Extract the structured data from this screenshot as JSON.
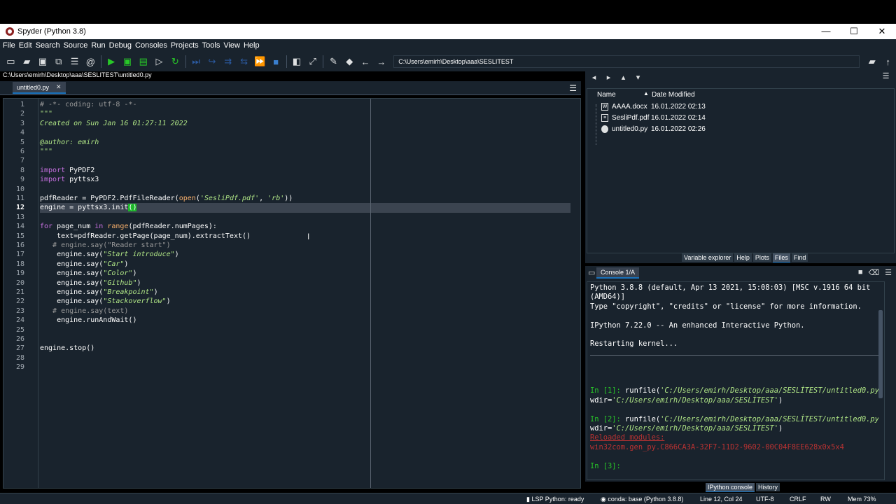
{
  "window": {
    "title": "Spyder (Python 3.8)",
    "controls": [
      "—",
      "☐",
      "✕"
    ]
  },
  "menu": [
    "File",
    "Edit",
    "Search",
    "Source",
    "Run",
    "Debug",
    "Consoles",
    "Projects",
    "Tools",
    "View",
    "Help"
  ],
  "toolbar": {
    "working_dir": "C:\\Users\\emirh\\Desktop\\aaa\\SESLITEST"
  },
  "editor": {
    "file_path": "C:\\Users\\emirh\\Desktop\\aaa\\SESLITEST\\untitled0.py",
    "tab_label": "untitled0.py",
    "current_line": 12,
    "line_numbers": [
      "1",
      "2",
      "3",
      "4",
      "5",
      "6",
      "7",
      "8",
      "9",
      "10",
      "11",
      "12",
      "13",
      "14",
      "15",
      "16",
      "17",
      "18",
      "19",
      "20",
      "21",
      "22",
      "23",
      "24",
      "25",
      "26",
      "27",
      "28",
      "29"
    ]
  },
  "files": {
    "col_name": "Name",
    "col_date": "Date Modified",
    "items": [
      {
        "name": "AAAA.docx",
        "date": "16.01.2022 02:13",
        "icon": "docx-file-icon"
      },
      {
        "name": "SesliPdf.pdf",
        "date": "16.01.2022 02:14",
        "icon": "pdf-file-icon"
      },
      {
        "name": "untitled0.py",
        "date": "16.01.2022 02:26",
        "icon": "python-file-icon"
      }
    ]
  },
  "top_pane_tabs": [
    "Variable explorer",
    "Help",
    "Plots",
    "Files",
    "Find"
  ],
  "top_pane_active": "Files",
  "console": {
    "tab_label": "Console 1/A",
    "banner1": "Python 3.8.8 (default, Apr 13 2021, 15:08:03) [MSC v.1916 64 bit",
    "banner2": "(AMD64)]",
    "banner3": "Type \"copyright\", \"credits\" or \"license\" for more information.",
    "ipython": "IPython 7.22.0 -- An enhanced Interactive Python.",
    "restart": "Restarting kernel...",
    "in1_prompt": "In [1]:",
    "in1_cmd": " runfile(",
    "in1_arg": "'C:/Users/emirh/Desktop/aaa/SESLİTEST/untitled0.py'",
    "in1_tail": ",",
    "in1_wdir": "wdir=",
    "in1_wdir_val": "'C:/Users/emirh/Desktop/aaa/SESLİTEST'",
    "in1_close": ")",
    "in2_prompt": "In [2]:",
    "in2_cmd": " runfile(",
    "in2_arg": "'C:/Users/emirh/Desktop/aaa/SESLİTEST/untitled0.py'",
    "in2_tail": ",",
    "in2_wdir": "wdir=",
    "in2_wdir_val": "'C:/Users/emirh/Desktop/aaa/SESLİTEST'",
    "in2_close": ")",
    "reloaded": "Reloaded modules:",
    "module": "win32com.gen_py.C866CA3A-32F7-11D2-9602-00C04F8EE628x0x5x4",
    "in3_prompt": "In [3]:"
  },
  "bottom_pane_tabs": [
    "IPython console",
    "History"
  ],
  "bottom_pane_active": "IPython console",
  "status": {
    "lsp": "LSP Python: ready",
    "conda": "conda: base (Python 3.8.8)",
    "position": "Line 12, Col 24",
    "encoding": "UTF-8",
    "eol": "CRLF",
    "perm": "RW",
    "mem": "Mem 73%"
  },
  "colors": {
    "background": "#19232d",
    "accent": "#1a72bb",
    "prompt": "#28c828",
    "string": "#b0e686",
    "keyword": "#c670e0"
  }
}
